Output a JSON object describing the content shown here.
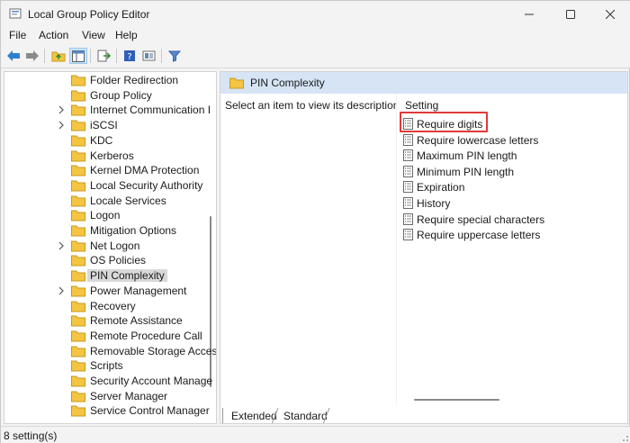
{
  "window": {
    "title": "Local Group Policy Editor"
  },
  "menu": [
    "File",
    "Action",
    "View",
    "Help"
  ],
  "toolbar": {
    "buttons": [
      "back-icon",
      "forward-icon",
      "up-folder-icon",
      "show-hide-tree-icon",
      "export-list-icon",
      "help-icon",
      "properties-icon",
      "filter-icon"
    ]
  },
  "tree": {
    "items": [
      {
        "label": "Folder Redirection",
        "expandable": false
      },
      {
        "label": "Group Policy",
        "expandable": false
      },
      {
        "label": "Internet Communication I",
        "expandable": true
      },
      {
        "label": "iSCSI",
        "expandable": true
      },
      {
        "label": "KDC",
        "expandable": false
      },
      {
        "label": "Kerberos",
        "expandable": false
      },
      {
        "label": "Kernel DMA Protection",
        "expandable": false
      },
      {
        "label": "Local Security Authority",
        "expandable": false
      },
      {
        "label": "Locale Services",
        "expandable": false
      },
      {
        "label": "Logon",
        "expandable": false
      },
      {
        "label": "Mitigation Options",
        "expandable": false
      },
      {
        "label": "Net Logon",
        "expandable": true
      },
      {
        "label": "OS Policies",
        "expandable": false
      },
      {
        "label": "PIN Complexity",
        "expandable": false,
        "selected": true
      },
      {
        "label": "Power Management",
        "expandable": true
      },
      {
        "label": "Recovery",
        "expandable": false
      },
      {
        "label": "Remote Assistance",
        "expandable": false
      },
      {
        "label": "Remote Procedure Call",
        "expandable": false
      },
      {
        "label": "Removable Storage Acces",
        "expandable": false
      },
      {
        "label": "Scripts",
        "expandable": false
      },
      {
        "label": "Security Account Manage",
        "expandable": false
      },
      {
        "label": "Server Manager",
        "expandable": false
      },
      {
        "label": "Service Control Manager",
        "expandable": false
      }
    ]
  },
  "right": {
    "title": "PIN Complexity",
    "description": "Select an item to view its description.",
    "column_header": "Setting",
    "settings": [
      "Require digits",
      "Require lowercase letters",
      "Maximum PIN length",
      "Minimum PIN length",
      "Expiration",
      "History",
      "Require special characters",
      "Require uppercase letters"
    ],
    "highlighted_index": 0
  },
  "tabs": {
    "extended": "Extended",
    "standard": "Standard"
  },
  "status": "8 setting(s)",
  "colors": {
    "header_bg": "#d6e4f5",
    "highlight": "#e03a3a",
    "folder": "#f4c542"
  }
}
